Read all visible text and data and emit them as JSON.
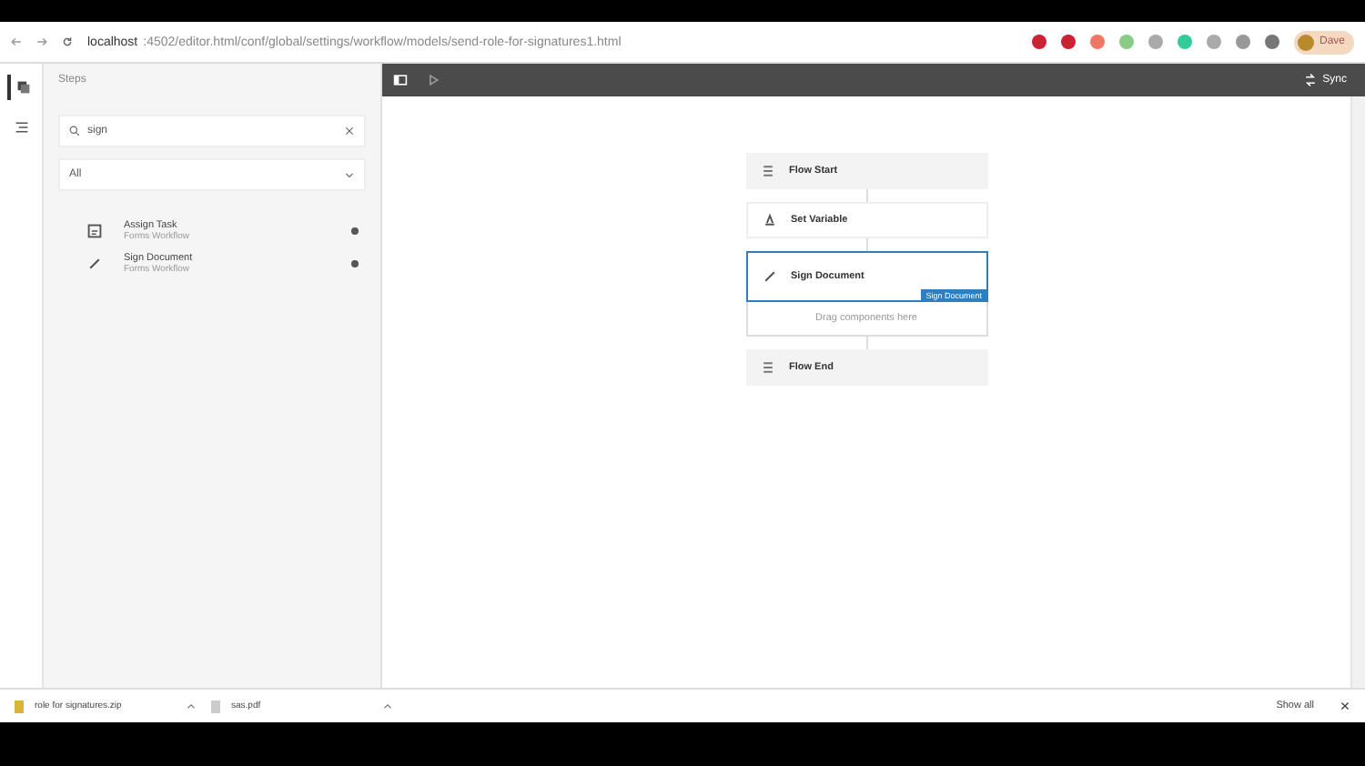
{
  "browser": {
    "url_host": "localhost",
    "url_path": ":4502/editor.html/conf/global/settings/workflow/models/send-role-for-signatures1.html",
    "profile": "Dave"
  },
  "rail": [
    {
      "kind": "steps",
      "selected": true
    },
    {
      "kind": "outline",
      "selected": false
    }
  ],
  "sidebar": {
    "title": "Steps",
    "search": {
      "value": "sign"
    },
    "filter": {
      "value": "All"
    },
    "items": [
      {
        "kind": "task",
        "title": "Assign Task",
        "subtitle": "Forms Workflow"
      },
      {
        "kind": "sign",
        "title": "Sign Document",
        "subtitle": "Forms Workflow"
      }
    ]
  },
  "toolbar": {
    "sync": "Sync"
  },
  "nodes": [
    {
      "kind": "flow",
      "label": "Flow Start",
      "selected": false
    },
    {
      "kind": "variable",
      "label": "Set Variable",
      "selected": false
    },
    {
      "kind": "sign",
      "label": "Sign Document",
      "selected": true,
      "tooltip": "Sign Document"
    },
    {
      "kind": "dropzone",
      "label": "Drag components here",
      "selected": false
    },
    {
      "kind": "flow",
      "label": "Flow End",
      "selected": false
    }
  ],
  "downloads": [
    {
      "kind": "zip",
      "name": "role for signatures.zip"
    },
    {
      "kind": "pdf",
      "name": "sas.pdf"
    }
  ],
  "show_all": "Show all"
}
